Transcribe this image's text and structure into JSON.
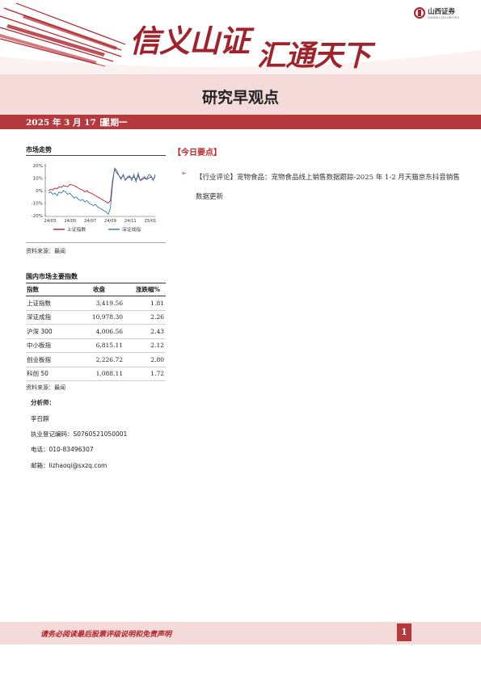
{
  "header": {
    "slogan_part1": "信义山证",
    "slogan_part2": "汇通天下",
    "logo_cn": "山西证券",
    "logo_en": "SHANXI SECURITIES",
    "report_title": "研究早观点"
  },
  "date_bar": {
    "date": "2025 年 3 月 17 日",
    "weekday": "星期一"
  },
  "market_trend": {
    "heading": "市场走势",
    "source": "资料来源：最闻",
    "chart_data": {
      "type": "line",
      "x_ticks": [
        "24/03",
        "24/05",
        "24/07",
        "24/09",
        "24/11",
        "25/01"
      ],
      "ylabels": [
        "20%",
        "10%",
        "0%",
        "-10%",
        "-20%"
      ],
      "ylim": [
        -20,
        20
      ],
      "legend_position": "bottom",
      "series": [
        {
          "name": "上证指数",
          "color": "#b2222b",
          "values": [
            0,
            1,
            0.5,
            2,
            1.5,
            3,
            2.5,
            4,
            3.5,
            3,
            5,
            4.5,
            4,
            3,
            2,
            1,
            0.5,
            -1,
            0,
            -1.5,
            -2,
            -3,
            -4,
            -5,
            -6,
            -7,
            -8,
            -9,
            -10,
            -8,
            8,
            17,
            14,
            12,
            10,
            12,
            9,
            10,
            11,
            10,
            11,
            9,
            12,
            8,
            9,
            10,
            9,
            10,
            11,
            9,
            11
          ]
        },
        {
          "name": "深证成指",
          "color": "#2a7ab8",
          "values": [
            -2,
            -1,
            -3,
            -2,
            -4,
            -1,
            -2,
            0,
            -1,
            -3,
            -2,
            -4,
            -6,
            -5,
            -7,
            -8,
            -7,
            -9,
            -8,
            -10,
            -11,
            -12,
            -11,
            -13,
            -14,
            -15,
            -16,
            -17,
            -19,
            -14,
            5,
            18,
            16,
            12,
            9,
            13,
            8,
            11,
            12,
            8,
            13,
            7,
            14,
            8,
            10,
            11,
            9,
            13,
            12,
            8,
            13
          ]
        }
      ]
    }
  },
  "indices": {
    "heading": "国内市场主要指数",
    "columns": [
      "指数",
      "收盘",
      "涨跌幅%"
    ],
    "rows": [
      [
        "上证指数",
        "3,419.56",
        "1.81"
      ],
      [
        "深证成指",
        "10,978.30",
        "2.26"
      ],
      [
        "沪深 300",
        "4,006.56",
        "2.43"
      ],
      [
        "中小板指",
        "6,815.11",
        "2.12"
      ],
      [
        "创业板指",
        "2,226.72",
        "2.80"
      ],
      [
        "科创 50",
        "1,088.11",
        "1.72"
      ]
    ],
    "source": "资料来源：最闻"
  },
  "analyst": {
    "label": "分析师：",
    "name": "李召麒",
    "license": "执业登记编码：S0760521050001",
    "phone": "电话：010-83496307",
    "email": "邮箱：lizhaoqi@sxzq.com"
  },
  "today": {
    "heading": "【今日要点】",
    "bullet": "➢",
    "items": [
      "【行业评论】宠物食品：宠物食品线上销售数据跟踪-2025 年 1-2 月天猫京东抖音销售数据更新"
    ]
  },
  "footer": {
    "disclaimer": "请务必阅读最后股票评级说明和免责声明",
    "page": "1"
  }
}
